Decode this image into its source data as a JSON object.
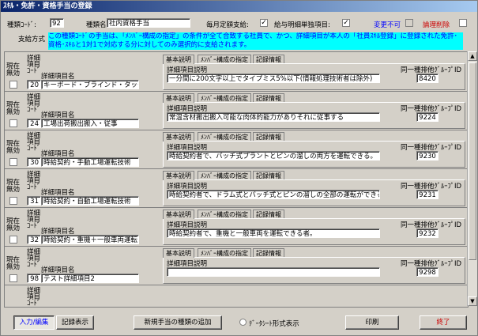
{
  "window": {
    "title": "ｽｷﾙ・免許・資格手当の登録"
  },
  "header": {
    "code_label": "種類ｺｰﾄﾞ:",
    "code_value": "92",
    "name_label": "種類名:",
    "name_value": "社内資格手当",
    "monthly_label": "毎月定額支給:",
    "monthly_checked": "✓",
    "payslip_label": "給与明細単独項目:",
    "payslip_checked": "✓",
    "unchangeable_label": "変更不可",
    "logical_delete_label": "論理削除",
    "payment_method_label": "支給方式",
    "payment_method_desc": "この種類ｺｰﾄﾞの手当は、「ﾒﾝﾊﾞｰ構成の指定」の条件が全て合致する社員で、かつ、詳細項目が本人の「社員ｽｷﾙ登録」に登録された免許･資格･ｽｷﾙと1対1で対応する分に対してのみ選択的に支給されます。"
  },
  "columns": {
    "current_invalid": "現在\n無効",
    "detail_code": "詳細\n項目\nｺｰﾄﾞ",
    "detail_name": "詳細項目名",
    "detail_desc": "詳細項目説明",
    "same_group_id": "同一種排他ｸﾞﾙｰﾌﾟID"
  },
  "tabs": [
    "基本説明",
    "ﾒﾝﾊﾞｰ構成の指定",
    "記録情報"
  ],
  "records": [
    {
      "code": "20",
      "name": "キーボード・ブラインド・タッチ",
      "desc": "一分間に200文字以上でタイプミス5%以下(情報処理技術者は除外)",
      "group_id": "8420"
    },
    {
      "code": "24",
      "name": "工場出荷搬出搬入・従事",
      "desc": "常温含材搬出搬入可能な肉体的能力がありそれに従事する",
      "group_id": "9224"
    },
    {
      "code": "30",
      "name": "時給契約・手動工場運転技術",
      "desc": "時給契約者で、バッチ式プラントとピンの溜しの両方を運転できる。",
      "group_id": "9230"
    },
    {
      "code": "31",
      "name": "時給契約・自動工場運転技術",
      "desc": "時給契約者で、ドラム式とバッチ式とピンの溜しの全部の運転ができる。",
      "group_id": "9231"
    },
    {
      "code": "32",
      "name": "時給契約・重機＋一般車両運転",
      "desc": "時給契約者で、重機と一般車両を運転できる者。",
      "group_id": "9232"
    },
    {
      "code": "98",
      "name": "テスト詳細項目2",
      "desc": "",
      "group_id": "9298"
    }
  ],
  "footer": {
    "input_edit": "入力/編集",
    "record_view": "記録表示",
    "add_new": "新規手当の種類の追加",
    "datasheet": "ﾃﾞｰﾀｼｰﾄ形式表示",
    "print": "印刷",
    "exit": "終了"
  },
  "colors": {
    "accent_cyan": "#00ffff",
    "title_blue": "#0a246a",
    "link_blue": "#0000ff",
    "alert_red": "#cc0000"
  }
}
